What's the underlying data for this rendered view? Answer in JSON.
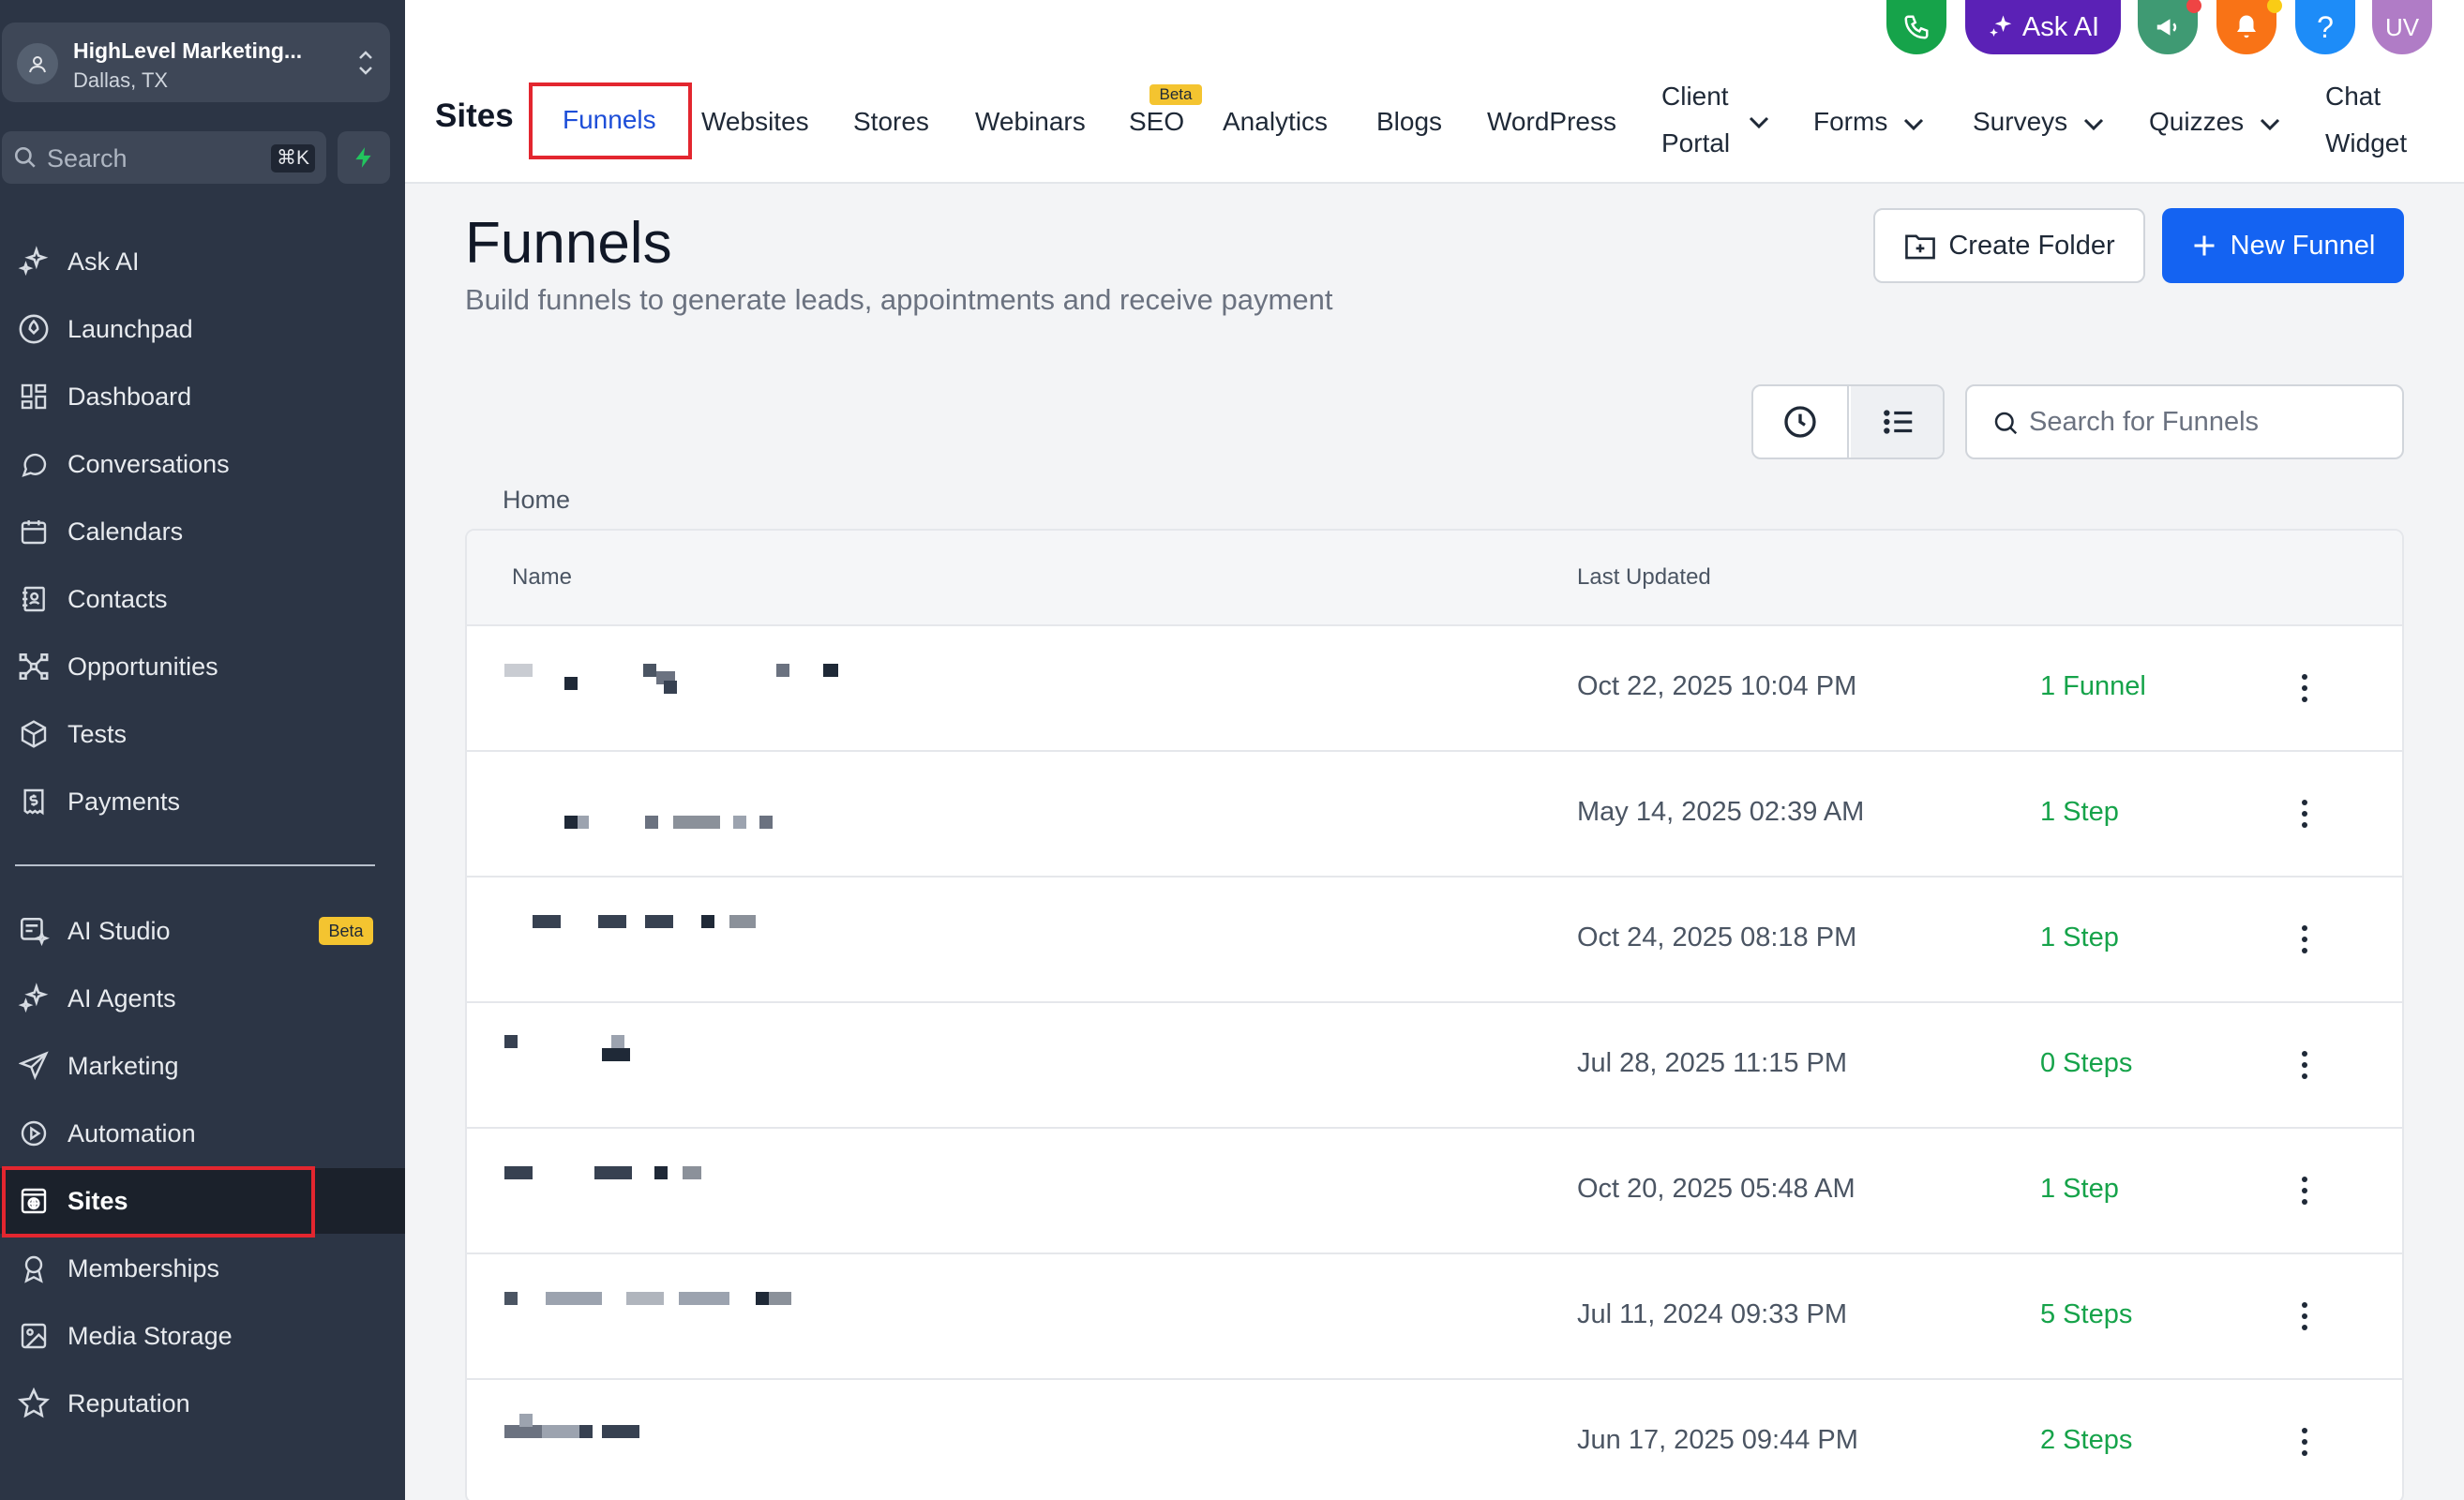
{
  "account": {
    "name": "HighLevel Marketing...",
    "location": "Dallas, TX"
  },
  "sidebar": {
    "search_label": "Search",
    "search_shortcut": "⌘K",
    "items": [
      {
        "label": "Ask AI",
        "icon": "sparkle-icon"
      },
      {
        "label": "Launchpad",
        "icon": "rocket-icon"
      },
      {
        "label": "Dashboard",
        "icon": "grid-icon"
      },
      {
        "label": "Conversations",
        "icon": "chat-icon"
      },
      {
        "label": "Calendars",
        "icon": "calendar-icon"
      },
      {
        "label": "Contacts",
        "icon": "contacts-icon"
      },
      {
        "label": "Opportunities",
        "icon": "network-icon"
      },
      {
        "label": "Tests",
        "icon": "cube-icon"
      },
      {
        "label": "Payments",
        "icon": "payments-icon"
      },
      {
        "label": "AI Studio",
        "icon": "ai-studio-icon",
        "badge": "Beta"
      },
      {
        "label": "AI Agents",
        "icon": "sparkle-icon"
      },
      {
        "label": "Marketing",
        "icon": "send-icon"
      },
      {
        "label": "Automation",
        "icon": "automation-icon"
      },
      {
        "label": "Sites",
        "icon": "globe-icon",
        "active": true
      },
      {
        "label": "Memberships",
        "icon": "badge-icon"
      },
      {
        "label": "Media Storage",
        "icon": "image-icon"
      },
      {
        "label": "Reputation",
        "icon": "star-icon"
      }
    ]
  },
  "topbar": {
    "ask_ai_label": "Ask AI",
    "help_label": "?",
    "avatar_initials": "UV",
    "section_title": "Sites",
    "tabs": [
      {
        "label": "Funnels",
        "active": true
      },
      {
        "label": "Websites"
      },
      {
        "label": "Stores"
      },
      {
        "label": "Webinars"
      },
      {
        "label": "SEO",
        "badge": "Beta"
      },
      {
        "label": "Analytics"
      },
      {
        "label": "Blogs"
      },
      {
        "label": "WordPress"
      },
      {
        "label_line1": "Client",
        "label_line2": "Portal"
      },
      {
        "label": "Forms"
      },
      {
        "label": "Surveys"
      },
      {
        "label": "Quizzes"
      },
      {
        "label_line1": "Chat",
        "label_line2": "Widget"
      }
    ]
  },
  "main": {
    "title": "Funnels",
    "subtitle": "Build funnels to generate leads, appointments and receive payment",
    "create_folder_label": "Create Folder",
    "new_funnel_label": "New Funnel",
    "search_placeholder": "Search for Funnels",
    "breadcrumb": "Home",
    "table": {
      "columns": [
        "Name",
        "Last Updated"
      ],
      "rows": [
        {
          "updated": "Oct 22, 2025 10:04 PM",
          "count": "1 Funnel"
        },
        {
          "updated": "May 14, 2025 02:39 AM",
          "count": "1 Step"
        },
        {
          "updated": "Oct 24, 2025 08:18 PM",
          "count": "1 Step"
        },
        {
          "updated": "Jul 28, 2025 11:15 PM",
          "count": "0 Steps"
        },
        {
          "updated": "Oct 20, 2025 05:48 AM",
          "count": "1 Step"
        },
        {
          "updated": "Jul 11, 2024 09:33 PM",
          "count": "5 Steps"
        },
        {
          "updated": "Jun 17, 2025 09:44 PM",
          "count": "2 Steps"
        }
      ]
    }
  },
  "colors": {
    "sidebar_bg": "#2c3545",
    "accent_blue": "#1463f2",
    "status_green": "#16a34a",
    "highlight_red": "#e3262f",
    "beta_yellow": "#f4c430"
  }
}
